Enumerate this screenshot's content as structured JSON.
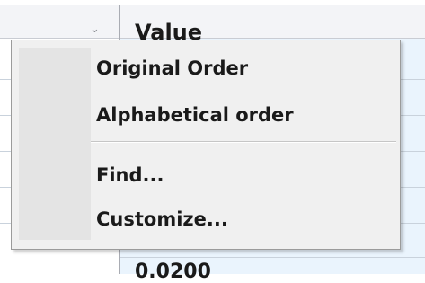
{
  "grid": {
    "header_value_label": "Value",
    "partial_value_below": "0.0200"
  },
  "menu": {
    "items": [
      {
        "label": "Original Order"
      },
      {
        "label": "Alphabetical order"
      },
      {
        "label": "Find..."
      },
      {
        "label": "Customize..."
      }
    ]
  },
  "colors": {
    "menu_background": "#f0f0f0",
    "value_column": "#eaf4fd",
    "header_background": "#f3f4f7"
  }
}
